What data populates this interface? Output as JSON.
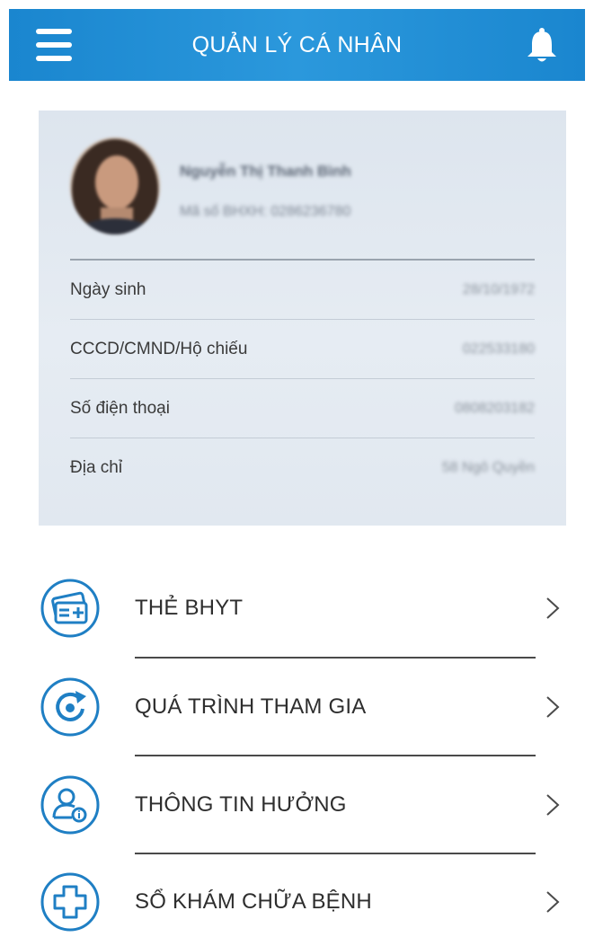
{
  "header": {
    "title": "QUẢN LÝ CÁ NHÂN",
    "menu_icon": "hamburger-menu-icon",
    "bell_icon": "bell-icon",
    "color": "#1a86cf"
  },
  "profile": {
    "name": "Nguyễn Thị Thanh Bình",
    "id_text": "Mã số BHXH: 0286236780",
    "fields": [
      {
        "label": "Ngày sinh",
        "value": "28/10/1972"
      },
      {
        "label": "CCCD/CMND/Hộ chiếu",
        "value": "022533180"
      },
      {
        "label": "Số điện thoại",
        "value": "0808203182"
      },
      {
        "label": "Địa chỉ",
        "value": "58 Ngô Quyền"
      }
    ]
  },
  "menu": [
    {
      "label": "THẺ BHYT",
      "icon": "health-card-icon"
    },
    {
      "label": "QUÁ TRÌNH THAM GIA",
      "icon": "history-refresh-icon"
    },
    {
      "label": "THÔNG TIN HƯỞNG",
      "icon": "user-info-icon"
    },
    {
      "label": "SỔ KHÁM CHỮA BỆNH",
      "icon": "medical-cross-icon"
    }
  ],
  "colors": {
    "accent": "#1a86cf",
    "icon_stroke": "#1f7fc4"
  }
}
